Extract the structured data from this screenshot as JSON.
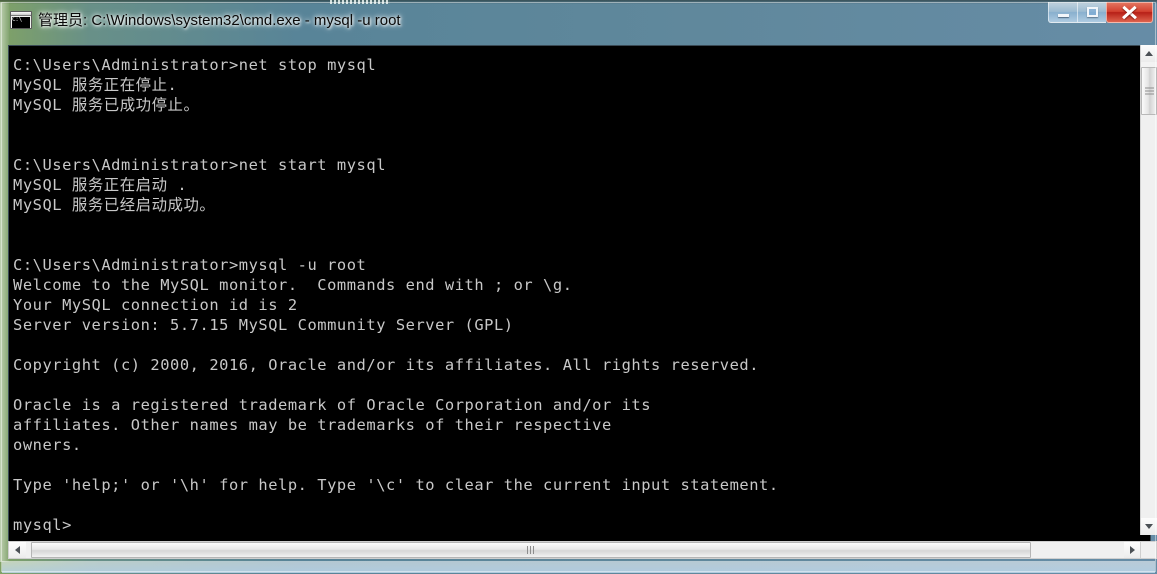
{
  "window": {
    "title": "管理员: C:\\Windows\\system32\\cmd.exe - mysql  -u root",
    "icon_name": "cmd-console-icon",
    "icon_text": "C:\\",
    "controls": {
      "minimize_label": "最小化",
      "maximize_label": "最大化",
      "close_label": "关闭"
    },
    "accent_close_color": "#c01c10",
    "frame_color": "#78a5c3"
  },
  "console": {
    "background_color": "#000000",
    "text_color": "#c8c8c8",
    "content": "C:\\Users\\Administrator>net stop mysql\nMySQL 服务正在停止.\nMySQL 服务已成功停止。\n\n\nC:\\Users\\Administrator>net start mysql\nMySQL 服务正在启动 .\nMySQL 服务已经启动成功。\n\n\nC:\\Users\\Administrator>mysql -u root\nWelcome to the MySQL monitor.  Commands end with ; or \\g.\nYour MySQL connection id is 2\nServer version: 5.7.15 MySQL Community Server (GPL)\n\nCopyright (c) 2000, 2016, Oracle and/or its affiliates. All rights reserved.\n\nOracle is a registered trademark of Oracle Corporation and/or its\naffiliates. Other names may be trademarks of their respective\nowners.\n\nType 'help;' or '\\h' for help. Type '\\c' to clear the current input statement.\n\nmysql>",
    "lines": [
      "C:\\Users\\Administrator>net stop mysql",
      "MySQL 服务正在停止.",
      "MySQL 服务已成功停止。",
      "",
      "",
      "C:\\Users\\Administrator>net start mysql",
      "MySQL 服务正在启动 .",
      "MySQL 服务已经启动成功。",
      "",
      "",
      "C:\\Users\\Administrator>mysql -u root",
      "Welcome to the MySQL monitor.  Commands end with ; or \\g.",
      "Your MySQL connection id is 2",
      "Server version: 5.7.15 MySQL Community Server (GPL)",
      "",
      "Copyright (c) 2000, 2016, Oracle and/or its affiliates. All rights reserved.",
      "",
      "Oracle is a registered trademark of Oracle Corporation and/or its",
      "affiliates. Other names may be trademarks of their respective",
      "owners.",
      "",
      "Type 'help;' or '\\h' for help. Type '\\c' to clear the current input statement.",
      "",
      "mysql>"
    ],
    "prompt": "mysql>",
    "mysql_version": "5.7.15",
    "mysql_edition": "MySQL Community Server (GPL)",
    "connection_id": "2"
  },
  "scrollbars": {
    "vertical": {
      "up_arrow": "▲",
      "down_arrow": "▼",
      "thumb_position_percent": 4
    },
    "horizontal": {
      "left_arrow": "◄",
      "right_arrow": "►",
      "thumb_position_percent": 0
    }
  }
}
